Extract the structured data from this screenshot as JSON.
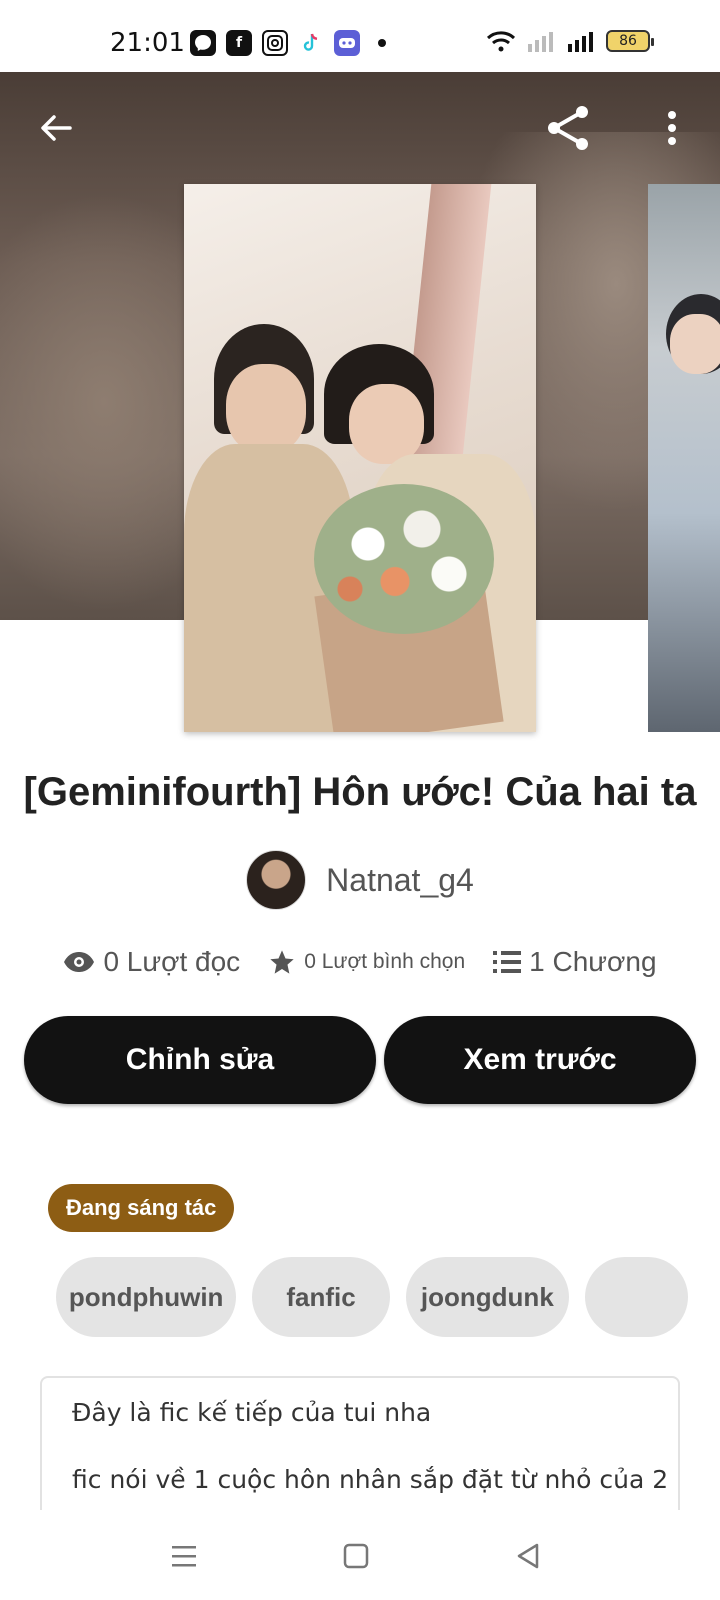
{
  "status_bar": {
    "time": "21:01",
    "battery": "86",
    "apps": [
      "facebook-messenger-icon",
      "facebook-icon",
      "instagram-icon",
      "tiktok-icon",
      "discord-icon"
    ]
  },
  "header": {
    "back_icon": "arrow-left-icon",
    "share_icon": "share-icon",
    "more_icon": "more-vertical-icon"
  },
  "story": {
    "title": "[Geminifourth] Hôn ước! Của hai ta",
    "author": "Natnat_g4",
    "stats": {
      "reads": "0 Lượt đọc",
      "votes": "0 Lượt bình chọn",
      "chapters": "1 Chương"
    },
    "actions": {
      "edit": "Chỉnh sửa",
      "preview": "Xem trước"
    },
    "status": "Đang sáng tác",
    "tags": [
      "pondphuwin",
      "fanfic",
      "joongdunk"
    ],
    "description": [
      "Đây là fic kế tiếp của tui nha",
      "",
      "fic nói về 1 cuộc hôn nhân sắp đặt từ nhỏ của 2"
    ]
  },
  "nav": {
    "menu": "menu-icon",
    "home": "square-icon",
    "back": "triangle-back-icon"
  },
  "colors": {
    "button_bg": "#121212",
    "badge_bg": "#8d5d14",
    "tag_bg": "#e4e4e4"
  }
}
